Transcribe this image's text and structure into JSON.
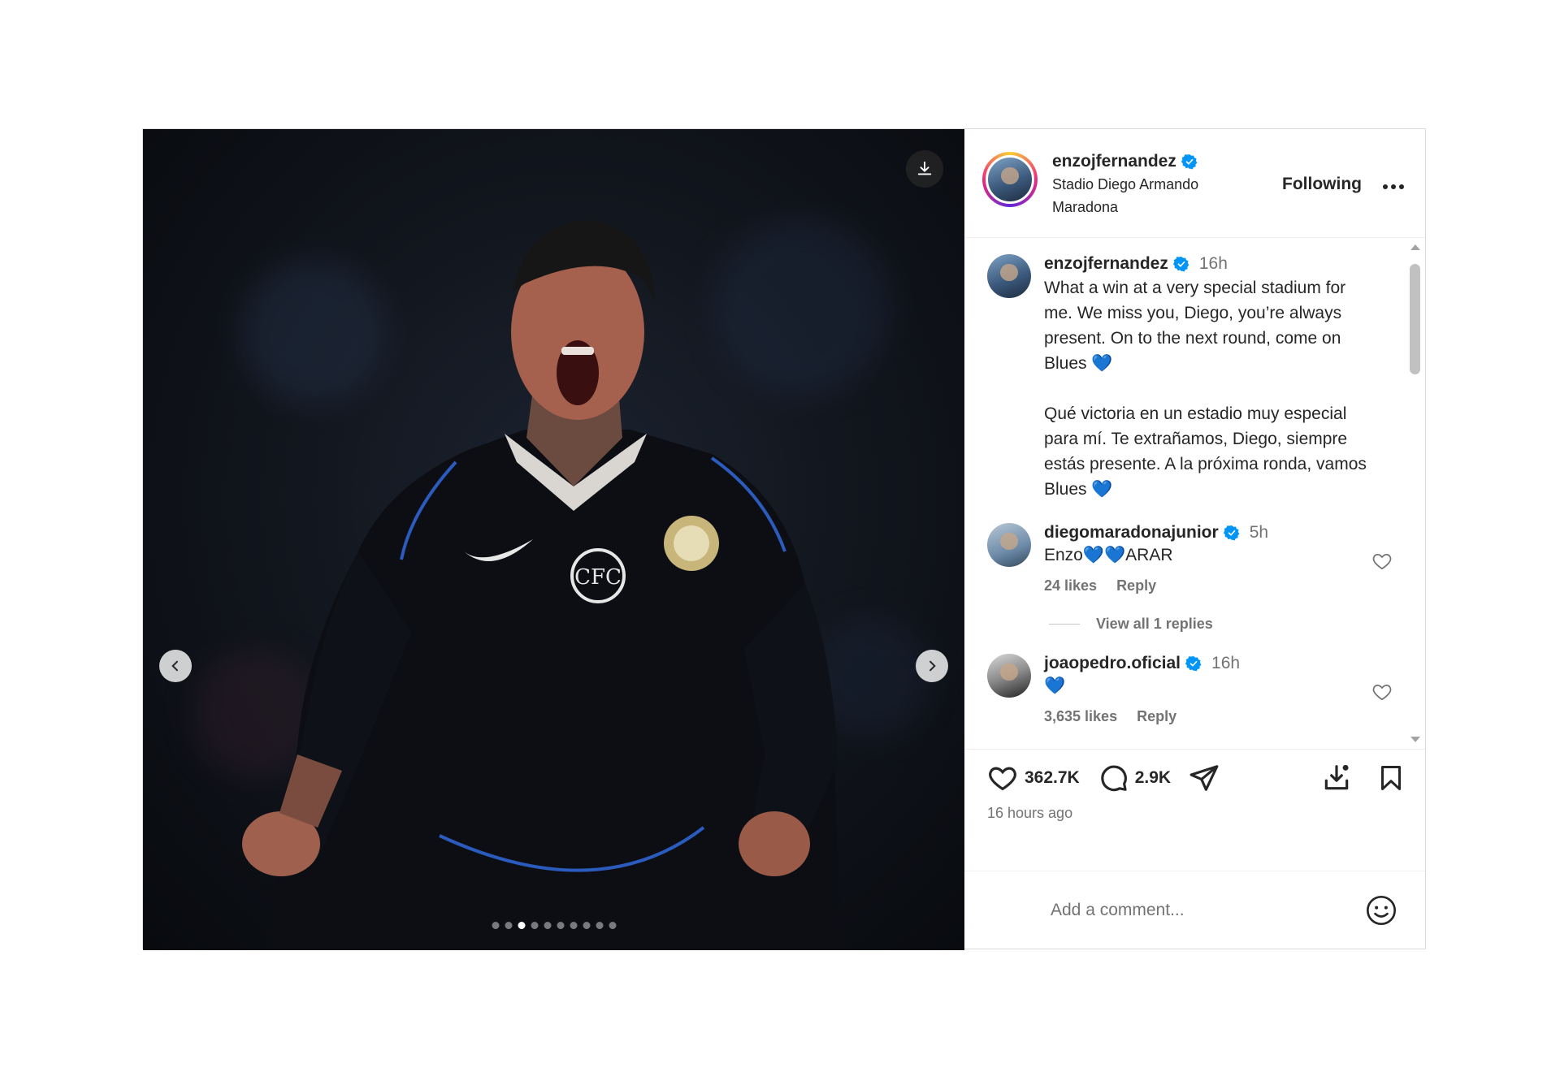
{
  "post": {
    "author": "enzojfernandez",
    "location": "Stadio Diego Armando Maradona",
    "follow_state": "Following",
    "carousel": {
      "slides": 10,
      "active_index": 2
    }
  },
  "caption": {
    "username": "enzojfernandez",
    "time": "16h",
    "text": "What a win at a very special stadium for me. We miss you, Diego, you’re always present. On to the next round, come on Blues 💙\n\nQué victoria en un estadio muy especial para mí. Te extrañamos, Diego, siempre estás presente. A la próxima ronda, vamos Blues 💙"
  },
  "comments": [
    {
      "username": "diegomaradonajunior",
      "time": "5h",
      "text": "Enzo💙💙ARAR",
      "likes": "24 likes",
      "reply": "Reply"
    },
    {
      "username": "joaopedro.oficial",
      "time": "16h",
      "text": "💙",
      "likes": "3,635 likes",
      "reply": "Reply"
    }
  ],
  "view_replies": "View all 1 replies",
  "stats": {
    "likes": "362.7K",
    "comments": "2.9K"
  },
  "time_ago": "16 hours ago",
  "comment_box": {
    "placeholder": "Add a comment..."
  },
  "colors": {
    "verified": "#0095f6",
    "heart_blue": "#1877f2",
    "text": "#262626",
    "muted": "#737373"
  }
}
